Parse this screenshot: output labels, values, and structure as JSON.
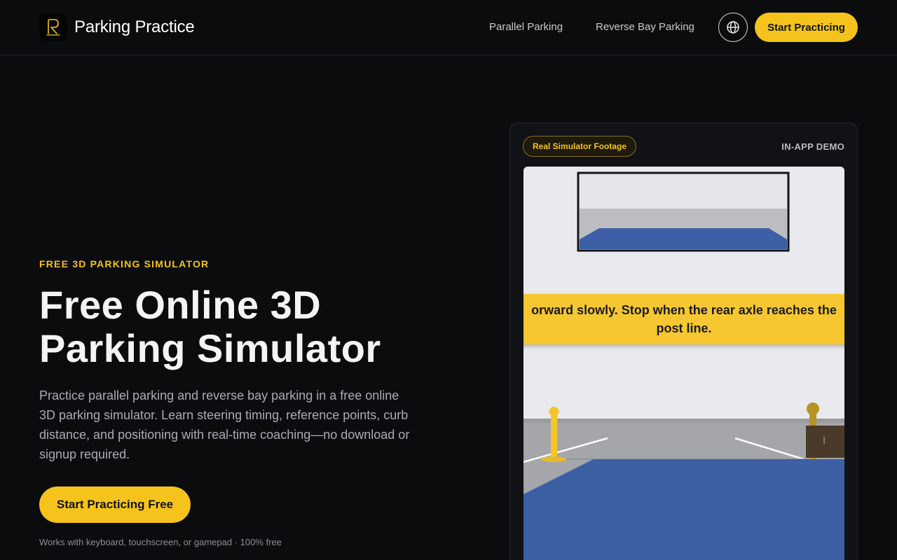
{
  "header": {
    "brand": "Parking Practice",
    "logo_icon": "parking-logo-icon",
    "nav": [
      {
        "label": "Parallel Parking"
      },
      {
        "label": "Reverse Bay Parking"
      }
    ],
    "language_icon": "globe-icon",
    "cta_label": "Start Practicing"
  },
  "hero": {
    "eyebrow": "FREE 3D PARKING SIMULATOR",
    "title_line1": "Free Online 3D",
    "title_line2": "Parking Simulator",
    "description": "Practice parallel parking and reverse bay parking in a free online 3D parking simulator. Learn steering timing, reference points, curb distance, and positioning with real-time coaching—no download or signup required.",
    "cta_label": "Start Practicing Free",
    "footnote": "Works with keyboard, touchscreen, or gamepad · 100% free"
  },
  "demo": {
    "badge": "Real Simulator Footage",
    "label": "IN-APP DEMO",
    "instruction_line1": "orward slowly. Stop when the rear axle reaches the",
    "instruction_line2": "post line."
  },
  "colors": {
    "accent": "#f5c31c",
    "background": "#0b0c0e",
    "car_blue": "#3d5fa3"
  }
}
